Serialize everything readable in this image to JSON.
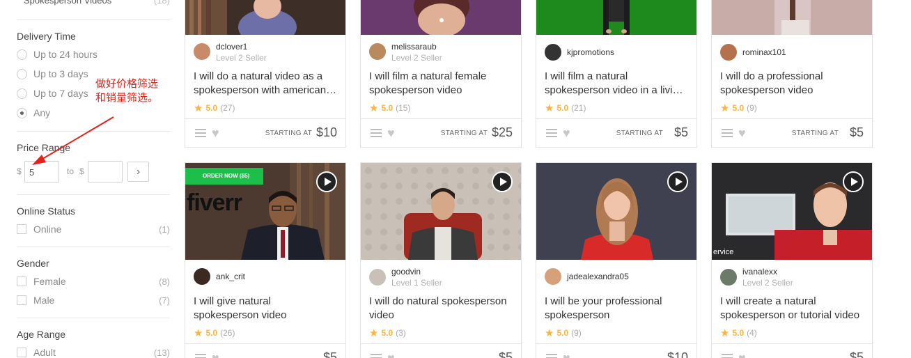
{
  "sidebar": {
    "top_item": {
      "label": "Spokesperson Videos",
      "count": "(18)"
    },
    "delivery": {
      "title": "Delivery Time",
      "options": [
        "Up to 24 hours",
        "Up to 3 days",
        "Up to 7 days",
        "Any"
      ],
      "selected": "Any"
    },
    "price": {
      "title": "Price Range",
      "currency": "$",
      "min_value": "5",
      "to": "to",
      "max_value": "",
      "go": "›"
    },
    "online": {
      "title": "Online Status",
      "options": [
        {
          "label": "Online",
          "count": "(1)"
        }
      ]
    },
    "gender": {
      "title": "Gender",
      "options": [
        {
          "label": "Female",
          "count": "(8)"
        },
        {
          "label": "Male",
          "count": "(7)"
        }
      ]
    },
    "age": {
      "title": "Age Range",
      "options": [
        {
          "label": "Adult",
          "count": "(13)"
        }
      ]
    }
  },
  "annotation": {
    "line1": "做好价格筛选",
    "line2": "和销量筛选。",
    "color": "#e2231a"
  },
  "cards": [
    {
      "seller": "dclover1",
      "level": "Level 2 Seller",
      "title": "I will do a natural video as a spokesperson with american accent",
      "rating": "5.0",
      "count": "(27)",
      "starting": "STARTING AT",
      "price": "$10"
    },
    {
      "seller": "melissaraub",
      "level": "Level 2 Seller",
      "title": "I will film a natural female spokesperson video",
      "rating": "5.0",
      "count": "(15)",
      "starting": "STARTING AT",
      "price": "$25"
    },
    {
      "seller": "kjpromotions",
      "level": "",
      "title": "I will film a natural spokesperson video in a living room",
      "rating": "5.0",
      "count": "(21)",
      "starting": "STARTING AT",
      "price": "$5"
    },
    {
      "seller": "rominax101",
      "level": "",
      "title": "I will do a professional spokesperson video",
      "rating": "5.0",
      "count": "(9)",
      "starting": "STARTING AT",
      "price": "$5"
    },
    {
      "seller": "ank_crit",
      "level": "",
      "title": "I will give natural spokesperson video",
      "rating": "5.0",
      "count": "(26)",
      "price": "$5",
      "thumb_text": "fiverr",
      "thumb_badge": "ORDER NOW ($5)"
    },
    {
      "seller": "goodvin",
      "level": "Level 1 Seller",
      "title": "I will do natural spokesperson video",
      "rating": "5.0",
      "count": "(3)",
      "price": "$5"
    },
    {
      "seller": "jadealexandra05",
      "level": "",
      "title": "I will be your professional spokesperson",
      "rating": "5.0",
      "count": "(9)",
      "price": "$10"
    },
    {
      "seller": "ivanalexx",
      "level": "Level 2 Seller",
      "title": "I will create a natural spokesperson or tutorial video",
      "rating": "5.0",
      "count": "(4)",
      "price": "$5",
      "thumb_text": "ervice"
    }
  ],
  "icons": {
    "star": "star-icon",
    "heart": "heart-icon",
    "menu": "menu-icon",
    "play": "play-icon"
  },
  "colors": {
    "star": "#ffb33e",
    "green_screen": "#1e8a1e",
    "fiverr_badge": "#1dbf4b"
  }
}
